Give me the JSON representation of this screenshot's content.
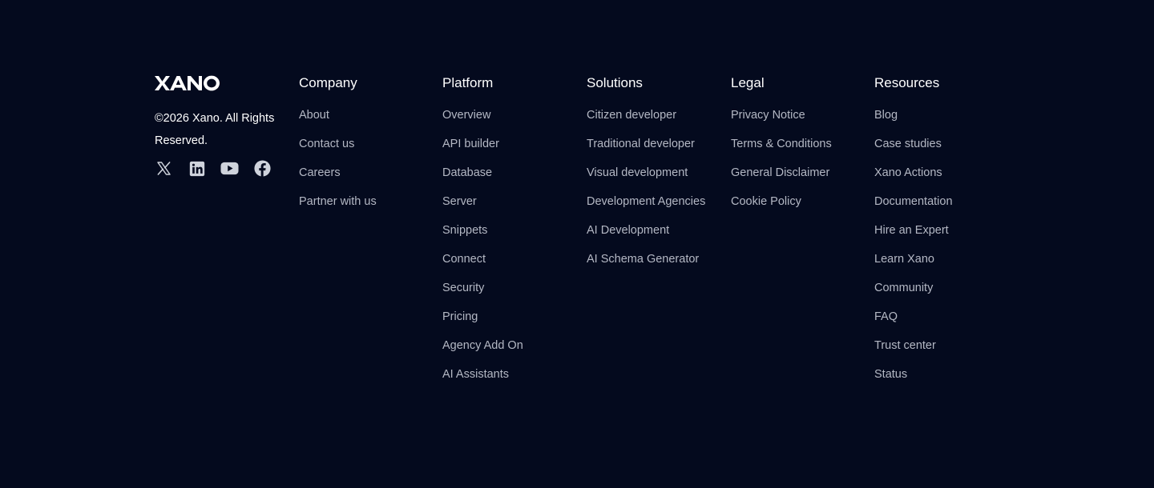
{
  "brand": {
    "logo_text": "XANO",
    "copyright": "©2026 Xano. All Rights Reserved.",
    "socials": [
      {
        "icon": "x-twitter-icon"
      },
      {
        "icon": "linkedin-icon"
      },
      {
        "icon": "youtube-icon"
      },
      {
        "icon": "facebook-icon"
      }
    ]
  },
  "columns": {
    "company": {
      "heading": "Company",
      "links": [
        "About",
        "Contact us",
        "Careers",
        "Partner with us"
      ]
    },
    "platform": {
      "heading": "Platform",
      "links": [
        "Overview",
        "API builder",
        "Database",
        "Server",
        "Snippets",
        "Connect",
        "Security",
        "Pricing",
        "Agency Add On",
        "AI Assistants"
      ]
    },
    "solutions": {
      "heading": "Solutions",
      "links": [
        "Citizen developer",
        "Traditional developer",
        "Visual development",
        "Development Agencies",
        "AI Development",
        "AI Schema Generator"
      ]
    },
    "legal": {
      "heading": "Legal",
      "links": [
        "Privacy Notice",
        "Terms & Conditions",
        "General Disclaimer",
        "Cookie Policy"
      ]
    },
    "resources": {
      "heading": "Resources",
      "links": [
        "Blog",
        "Case studies",
        "Xano Actions",
        "Documentation",
        "Hire an Expert",
        "Learn Xano",
        "Community",
        "FAQ",
        "Trust center",
        "Status"
      ]
    }
  },
  "colors": {
    "background": "#040a1e",
    "heading": "#ffffff",
    "link": "#b4b8c4"
  }
}
